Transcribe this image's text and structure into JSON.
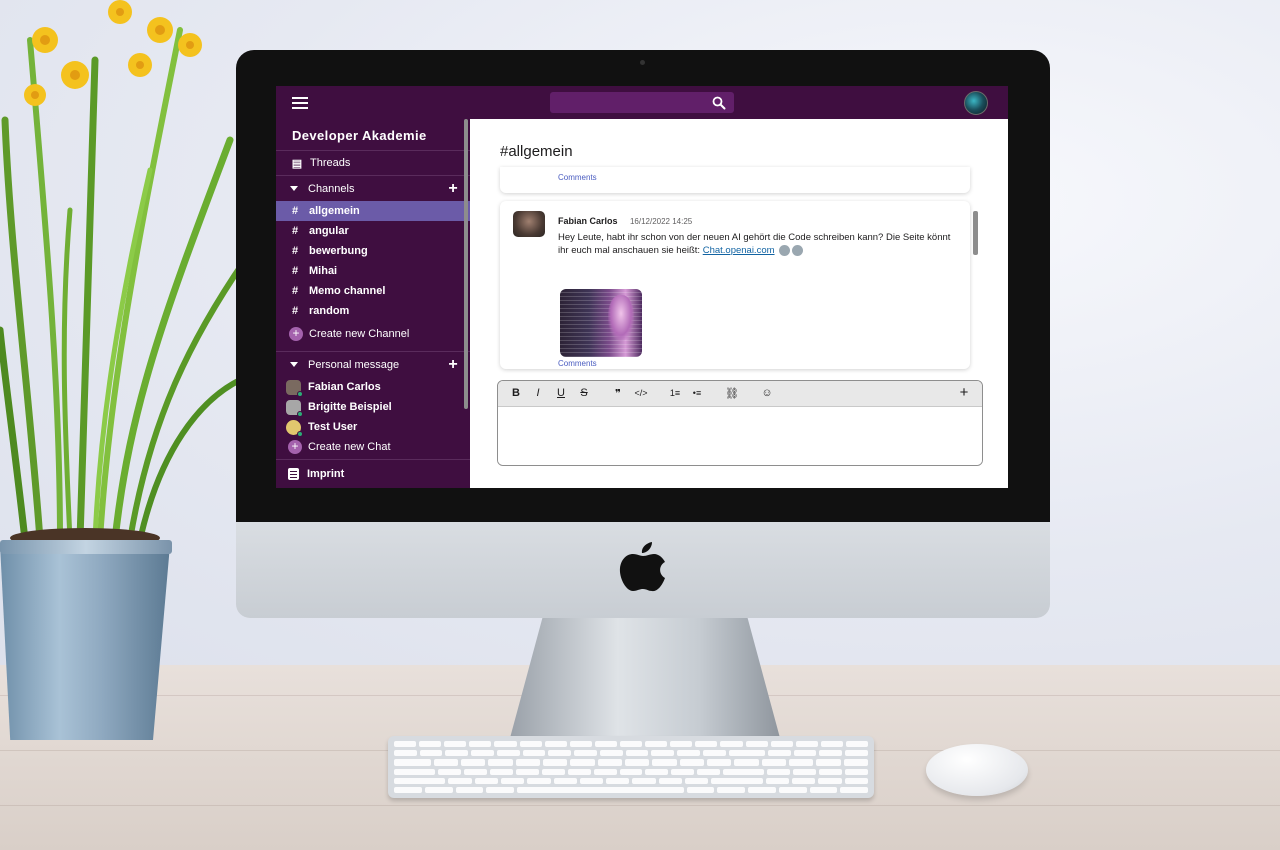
{
  "app": {
    "workspace_name": "Developer Akademie",
    "accent_color": "#3f0e40",
    "active_channel_color": "#6b5ba8"
  },
  "topbar": {
    "menu_icon": "hamburger-icon",
    "search_placeholder": "",
    "search_icon": "search-icon"
  },
  "sidebar": {
    "threads_label": "Threads",
    "channels_label": "Channels",
    "channels": [
      {
        "label": "allgemein",
        "active": true
      },
      {
        "label": "angular",
        "active": false
      },
      {
        "label": "bewerbung",
        "active": false
      },
      {
        "label": "Mihai",
        "active": false
      },
      {
        "label": "Memo channel",
        "active": false
      },
      {
        "label": "random",
        "active": false
      }
    ],
    "create_channel_label": "Create new Channel",
    "personal_label": "Personal message",
    "dms": [
      {
        "label": "Fabian Carlos",
        "online": true
      },
      {
        "label": "Brigitte Beispiel",
        "online": true
      },
      {
        "label": "Test User",
        "online": true
      }
    ],
    "create_chat_label": "Create new Chat",
    "imprint_label": "Imprint"
  },
  "main": {
    "channel_title": "allgemein",
    "previous_message_comments": "Comments",
    "message": {
      "author": "Fabian Carlos",
      "timestamp": "16/12/2022 14:25",
      "text": "Hey Leute, habt ihr schon von der neuen AI gehört die Code schreiben kann? Die Seite könnt ihr euch mal anschauen sie heißt:",
      "link": "Chat.openai.com",
      "comments": "Comments"
    }
  },
  "editor": {
    "toolbar": [
      "B",
      "I",
      "U",
      "S",
      "❞",
      "</>",
      "1≡",
      "•≡",
      "⛓",
      "☺",
      "+"
    ],
    "placeholder": ""
  }
}
